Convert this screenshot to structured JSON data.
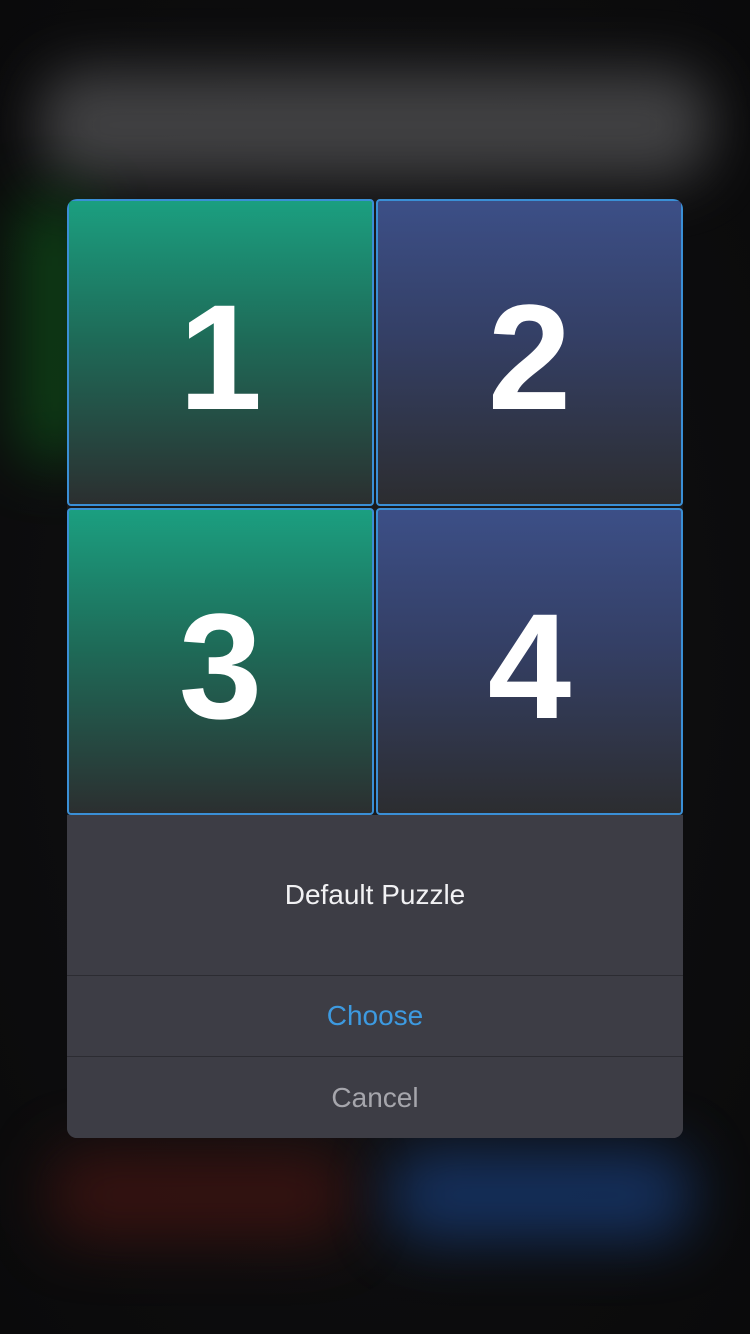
{
  "puzzle": {
    "tiles": [
      {
        "label": "1",
        "color": "#1b9f80"
      },
      {
        "label": "2",
        "color": "#3c4f87"
      },
      {
        "label": "3",
        "color": "#1b9f80"
      },
      {
        "label": "4",
        "color": "#3c4f87"
      }
    ],
    "border_color": "#3a8fd6"
  },
  "sheet": {
    "title": "Default Puzzle",
    "choose_label": "Choose",
    "cancel_label": "Cancel",
    "accent_color": "#3d9ae0"
  }
}
